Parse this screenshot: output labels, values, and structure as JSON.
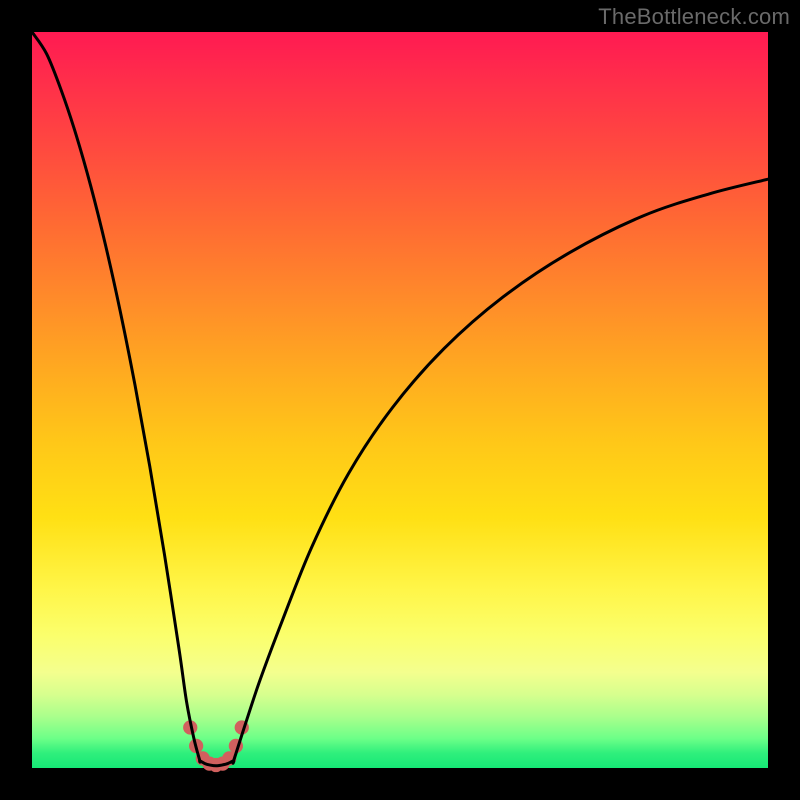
{
  "watermark": {
    "text": "TheBottleneck.com"
  },
  "colors": {
    "curve_stroke": "#000000",
    "marker_fill": "#d1605e",
    "marker_stroke": "#d1605e"
  },
  "chart_data": {
    "type": "line",
    "title": "",
    "xlabel": "",
    "ylabel": "",
    "xlim": [
      0,
      100
    ],
    "ylim": [
      0,
      100
    ],
    "grid": false,
    "legend": false,
    "series": [
      {
        "name": "left-curve",
        "x": [
          0,
          2,
          4,
          6,
          8,
          10,
          12,
          14,
          16,
          18,
          20,
          21,
          22,
          22.8
        ],
        "values": [
          100,
          97,
          92,
          86,
          79,
          71,
          62,
          52,
          41,
          29,
          16,
          9,
          4,
          1
        ]
      },
      {
        "name": "valley-floor",
        "x": [
          22.8,
          23.5,
          24.2,
          25.0,
          25.8,
          26.6,
          27.4
        ],
        "values": [
          1.0,
          0.6,
          0.4,
          0.3,
          0.4,
          0.6,
          1.0
        ]
      },
      {
        "name": "right-curve",
        "x": [
          27.4,
          29,
          31,
          34,
          38,
          43,
          49,
          56,
          64,
          73,
          83,
          92,
          100
        ],
        "values": [
          1,
          6,
          12,
          20,
          30,
          40,
          49,
          57,
          64,
          70,
          75,
          78,
          80
        ]
      }
    ],
    "markers": {
      "name": "valley-markers",
      "points": [
        {
          "x": 21.5,
          "y": 5.5
        },
        {
          "x": 22.3,
          "y": 3.0
        },
        {
          "x": 23.2,
          "y": 1.3
        },
        {
          "x": 24.1,
          "y": 0.6
        },
        {
          "x": 25.0,
          "y": 0.4
        },
        {
          "x": 25.9,
          "y": 0.6
        },
        {
          "x": 26.8,
          "y": 1.3
        },
        {
          "x": 27.7,
          "y": 3.0
        },
        {
          "x": 28.5,
          "y": 5.5
        }
      ],
      "radius_data_units": 0.9
    }
  }
}
